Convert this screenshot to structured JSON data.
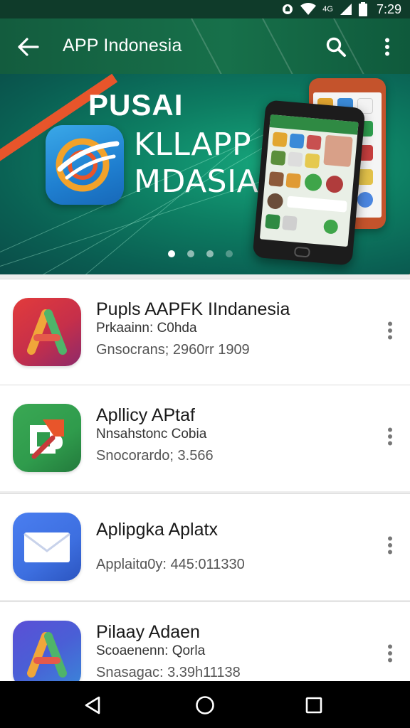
{
  "status_bar": {
    "time": "7:29",
    "network_label": "4G",
    "icons": [
      "notification-icon",
      "wifi-icon",
      "signal-icon",
      "battery-icon"
    ]
  },
  "app_bar": {
    "title": "APP Indonesia",
    "back_icon": "arrow-back-icon",
    "search_icon": "search-icon",
    "more_icon": "more-vert-icon"
  },
  "banner": {
    "title_line1": "PUSAI",
    "title_line2": "KLLAPP",
    "title_line3": "MDASIA",
    "carousel": {
      "total": 4,
      "active": 0
    }
  },
  "apps": [
    {
      "title": "Pupls AAPFK IIndanesia",
      "subtitle": "Prkaainn: C0hda",
      "meta": "Gnsocrans; 2960rr 1909",
      "icon": "stylized-a-icon",
      "icon_bg": "#c62f4a"
    },
    {
      "title": "Apllicy APtaf",
      "subtitle": "Nnsahstonc Cobia",
      "meta": "Snocorardo; 3.566",
      "icon": "puzzle-arrow-icon",
      "icon_bg": "#2f9b4c"
    },
    {
      "title": "Aplipgka Aplatx",
      "subtitle": "",
      "meta": "Applaitɑ0y: 445:011330",
      "icon": "mail-icon",
      "icon_bg": "#3d6fe0"
    },
    {
      "title": "Pilaay Adaen",
      "subtitle": "Scoaenenn: Qorla",
      "meta": "Snasagac: 3.39h11138",
      "icon": "stylized-a-icon",
      "icon_bg": "#4a5fd6"
    }
  ],
  "nav_bar": {
    "back": "nav-back-icon",
    "home": "nav-home-icon",
    "recents": "nav-recents-icon"
  },
  "colors": {
    "status_bar": "#0f3b2a",
    "app_bar": "#17704a",
    "banner": "#0d7d62",
    "accent_red": "#e8552b",
    "nav_bar": "#000000"
  }
}
